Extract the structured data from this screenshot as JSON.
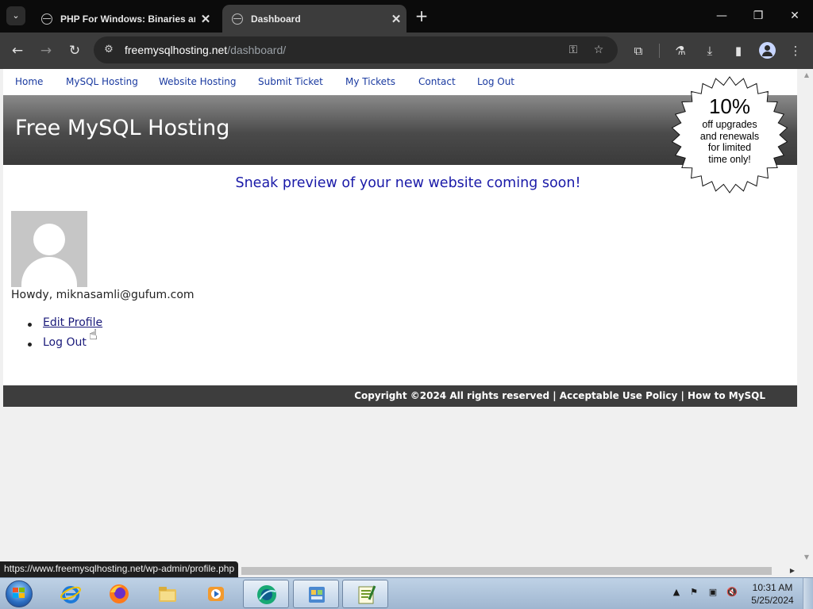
{
  "browser": {
    "tabs": [
      {
        "title": "PHP For Windows: Binaries and",
        "active": false
      },
      {
        "title": "Dashboard",
        "active": true
      }
    ],
    "url_host": "freemysqlhosting.net",
    "url_path": "/dashboard/",
    "status_url": "https://www.freemysqlhosting.net/wp-admin/profile.php"
  },
  "site": {
    "menu": [
      "Home",
      "MySQL Hosting",
      "Website Hosting",
      "Submit Ticket",
      "My Tickets",
      "Contact",
      "Log Out"
    ],
    "banner_title": "Free MySQL Hosting",
    "promo": {
      "percent": "10%",
      "lines": [
        "off upgrades",
        "and renewals",
        "for limited",
        "time only!"
      ]
    },
    "preview_text": "Sneak preview of your new website coming soon!",
    "greeting": "Howdy, miknasamli@gufum.com",
    "links": [
      "Edit Profile",
      "Log Out"
    ],
    "footer": "Copyright ©2024 All rights reserved | Acceptable Use Policy | How to MySQL"
  },
  "taskbar": {
    "time": "10:31 AM",
    "date": "5/25/2024"
  },
  "colors": {
    "link_blue": "#1a3aa0",
    "preview_blue": "#1a1aa8",
    "banner_dark": "#3a3a3a",
    "footer_bg": "#3d3d3d"
  }
}
